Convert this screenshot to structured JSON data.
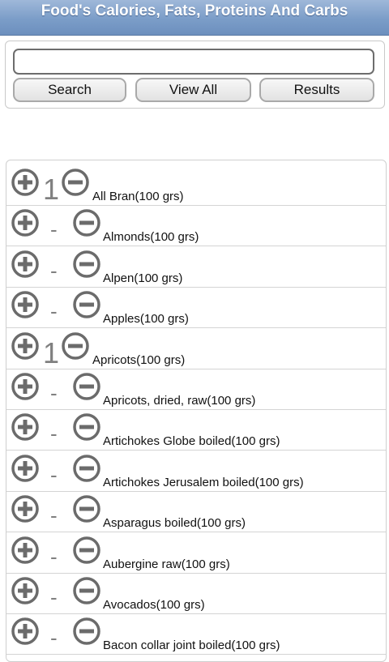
{
  "header": {
    "title": "Food's Calories, Fats, Proteins And Carbs"
  },
  "search": {
    "value": "",
    "placeholder": "",
    "buttons": {
      "search": "Search",
      "view_all": "View All",
      "results": "Results"
    }
  },
  "icons": {
    "add": "plus-circle-icon",
    "remove": "minus-circle-icon",
    "icon_color": "#6b6b6b"
  },
  "foods": [
    {
      "label": "All Bran(100 grs)",
      "qty": "1"
    },
    {
      "label": "Almonds(100 grs)",
      "qty": "-"
    },
    {
      "label": "Alpen(100 grs)",
      "qty": "-"
    },
    {
      "label": "Apples(100 grs)",
      "qty": "-"
    },
    {
      "label": "Apricots(100 grs)",
      "qty": "1"
    },
    {
      "label": "Apricots, dried, raw(100 grs)",
      "qty": "-"
    },
    {
      "label": "Artichokes Globe boiled(100 grs)",
      "qty": "-"
    },
    {
      "label": "Artichokes Jerusalem boiled(100 grs)",
      "qty": "-"
    },
    {
      "label": "Asparagus boiled(100 grs)",
      "qty": "-"
    },
    {
      "label": "Aubergine raw(100 grs)",
      "qty": "-"
    },
    {
      "label": "Avocados(100 grs)",
      "qty": "-"
    },
    {
      "label": "Bacon collar joint boiled(100 grs)",
      "qty": "-"
    }
  ]
}
